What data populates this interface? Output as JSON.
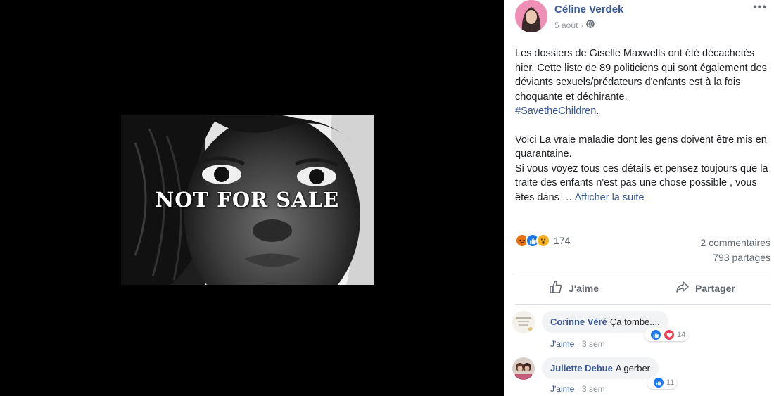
{
  "photo": {
    "caption": "NOT FOR SALE"
  },
  "post": {
    "author": "Céline Verdek",
    "date": "5 août",
    "audience_icon": "globe-icon",
    "more_label": "•••",
    "text": {
      "p1": "Les dossiers de Giselle Maxwells ont été décachetés hier. Cette liste de 89 politiciens qui sont également des déviants sexuels/prédateurs d'enfants est à la fois choquante et déchirante.",
      "hashtag": "#SavetheChildren",
      "hashtag_suffix": ".",
      "p2": "Voici La vraie maladie dont les gens doivent être mis en quarantaine.",
      "p3": "Si vous voyez tous ces détails et pensez toujours que la traite des enfants n'est pas une chose possible , vous êtes dans …",
      "see_more": "Afficher la suite"
    },
    "reactions": {
      "icons": [
        "angry-icon",
        "like-icon",
        "wow-icon"
      ],
      "count": "174"
    },
    "comments_count": "2 commentaires",
    "shares_count": "793 partages",
    "actions": {
      "like": "J'aime",
      "share": "Partager"
    }
  },
  "comments": [
    {
      "name": "Corinne Véré",
      "text": "Ça tombe....",
      "like": "J'aime",
      "sep": "·",
      "time": "3 sem",
      "reaction_icons": [
        "like-icon",
        "love-icon"
      ],
      "reaction_count": "14"
    },
    {
      "name": "Juliette Debue",
      "text": "A gerber",
      "like": "J'aime",
      "sep": "·",
      "time": "3 sem",
      "reaction_icons": [
        "like-icon"
      ],
      "reaction_count": "11"
    }
  ],
  "colors": {
    "link": "#385898",
    "like_blue": "#1877f2",
    "love_red": "#f33e58",
    "angry_orange": "#e9710f",
    "wow_yellow": "#f7b125"
  }
}
